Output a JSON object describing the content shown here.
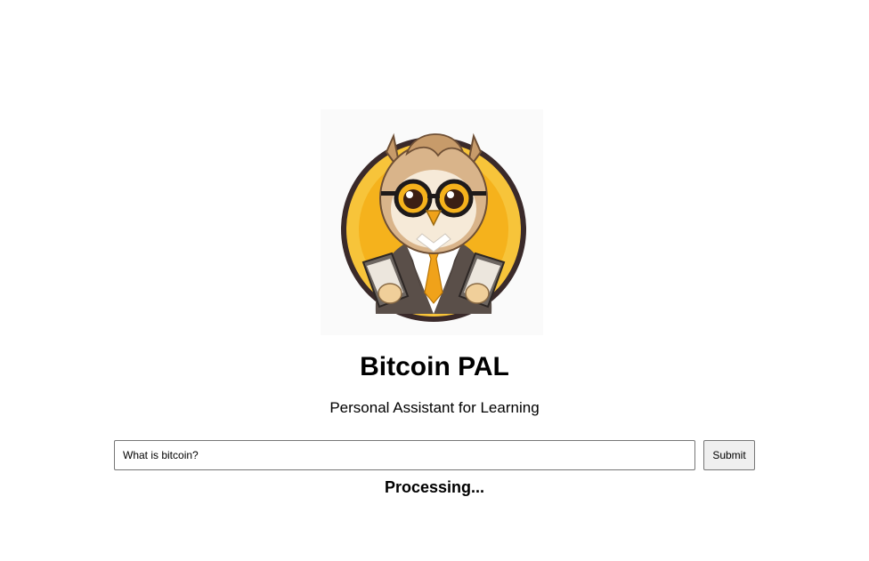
{
  "logo": {
    "icon": "owl-mascot-icon",
    "colors": {
      "ring": "#3a2a2a",
      "disc": "#f5b21c",
      "feathers": "#d9b48a",
      "face": "#f6ead8",
      "suit": "#5a4f49",
      "tie": "#f0a21a"
    }
  },
  "header": {
    "title": "Bitcoin PAL",
    "subtitle": "Personal Assistant for Learning"
  },
  "search": {
    "value": "What is bitcoin?",
    "placeholder": ""
  },
  "actions": {
    "submit_label": "Submit"
  },
  "status": {
    "text": "Processing..."
  }
}
